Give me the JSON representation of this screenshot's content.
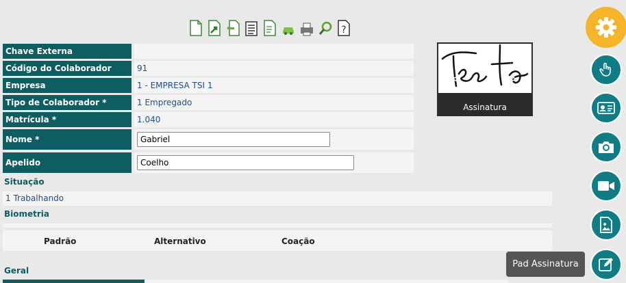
{
  "toolbar": {
    "icons": [
      "new-document-icon",
      "export-icon",
      "undo-icon",
      "report-icon",
      "document-list-icon",
      "vehicle-icon",
      "printer-icon",
      "search-icon",
      "help-icon"
    ]
  },
  "form": {
    "chave_externa": {
      "label": "Chave Externa",
      "value": ""
    },
    "codigo": {
      "label": "Código do Colaborador",
      "value": "91"
    },
    "empresa": {
      "label": "Empresa",
      "value": "1 - EMPRESA TSI 1"
    },
    "tipo": {
      "label": "Tipo de Colaborador *",
      "value": "1 Empregado"
    },
    "matricula": {
      "label": "Matrícula *",
      "value": "1.040"
    },
    "nome": {
      "label": "Nome *",
      "value": "Gabriel"
    },
    "apelido": {
      "label": "Apelido",
      "value": "Coelho"
    }
  },
  "situacao": {
    "title": "Situação",
    "value": "1 Trabalhando"
  },
  "biometria": {
    "title": "Biometria",
    "columns": [
      "Padrão",
      "Alternativo",
      "Coação"
    ]
  },
  "geral": {
    "title": "Geral"
  },
  "signature": {
    "caption": "Assinatura",
    "prev": "<",
    "next": ">",
    "handwriting": "Testo"
  },
  "fab": {
    "main_icon": "gear-icon",
    "items": [
      "touch-icon",
      "id-card-icon",
      "camera-icon",
      "video-icon",
      "image-icon",
      "edit-signature-icon"
    ],
    "tooltip": "Pad Assinatura"
  },
  "colors": {
    "label_bg": "#0e5e61",
    "fab_main": "#f6b42a",
    "fab_item": "#0f7c86",
    "value_text": "#1d4f8a"
  }
}
